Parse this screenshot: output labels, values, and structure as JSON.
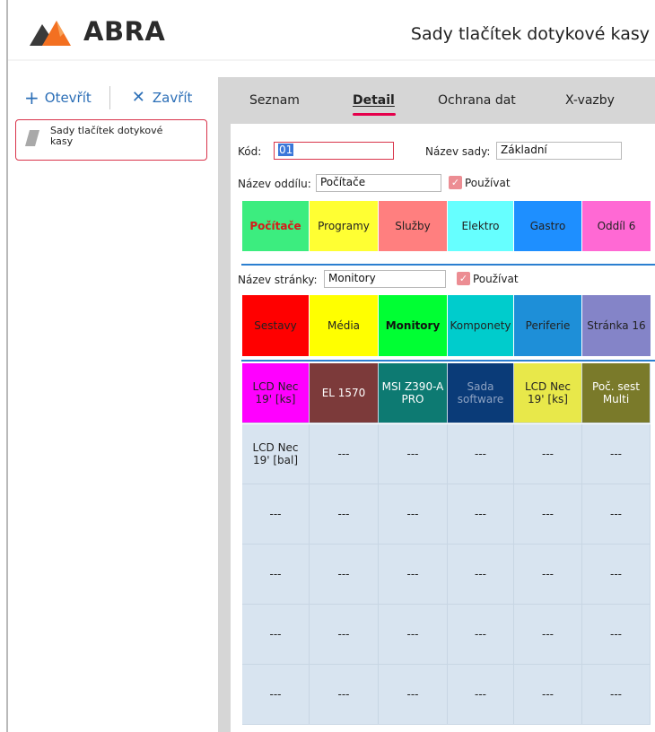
{
  "app": {
    "logo_text": "ABRA",
    "title": "Sady tlačítek dotykové kasy"
  },
  "toolbar": {
    "open_label": "Otevřít",
    "close_label": "Zavřít"
  },
  "sidebar": {
    "items": [
      {
        "label": "Sady tlačítek dotykové kasy",
        "active": true
      }
    ]
  },
  "tabs": [
    {
      "label": "Seznam",
      "active": false
    },
    {
      "label": "Detail",
      "active": true
    },
    {
      "label": "Ochrana dat",
      "active": false
    },
    {
      "label": "X-vazby",
      "active": false
    }
  ],
  "form": {
    "kod_label": "Kód:",
    "kod_value": "01",
    "nazev_sady_label": "Název sady:",
    "nazev_sady_value": "Základní",
    "nazev_oddilu_label": "Název oddílu:",
    "nazev_oddilu_value": "Počítače",
    "oddil_pouzivat_label": "Používat",
    "oddil_pouzivat_checked": true,
    "nazev_stranky_label": "Název stránky:",
    "nazev_stranky_value": "Monitory",
    "stranka_pouzivat_label": "Používat",
    "stranka_pouzivat_checked": true
  },
  "sections": [
    {
      "label": "Počítače",
      "bg": "#3ced7f",
      "color": "#d71a1a",
      "bold": true
    },
    {
      "label": "Programy",
      "bg": "#ffff33",
      "color": "#222222",
      "bold": false
    },
    {
      "label": "Služby",
      "bg": "#ff7f7f",
      "color": "#222222",
      "bold": false
    },
    {
      "label": "Elektro",
      "bg": "#66ffff",
      "color": "#222222",
      "bold": false
    },
    {
      "label": "Gastro",
      "bg": "#1e8fff",
      "color": "#222222",
      "bold": false
    },
    {
      "label": "Oddíl 6",
      "bg": "#ff69d4",
      "color": "#222222",
      "bold": false
    }
  ],
  "pages": [
    {
      "label": "Sestavy",
      "bg": "#ff0000",
      "color": "#222222",
      "bold": false
    },
    {
      "label": "Média",
      "bg": "#ffff00",
      "color": "#222222",
      "bold": false
    },
    {
      "label": "Monitory",
      "bg": "#00ff33",
      "color": "#111111",
      "bold": true
    },
    {
      "label": "Komponety",
      "bg": "#00cccc",
      "color": "#222222",
      "bold": false
    },
    {
      "label": "Periferie",
      "bg": "#1e8fd8",
      "color": "#222222",
      "bold": false
    },
    {
      "label": "Stránka 16",
      "bg": "#8484c8",
      "color": "#222222",
      "bold": false
    }
  ],
  "buttons": [
    [
      {
        "label": "LCD Nec 19' [ks]",
        "bg": "#ff00ff",
        "color": "#222222"
      },
      {
        "label": "EL 1570",
        "bg": "#7c3a3a",
        "color": "#ffffff"
      },
      {
        "label": "MSI Z390-A PRO",
        "bg": "#0d7a72",
        "color": "#ffffff"
      },
      {
        "label": "Sada software",
        "bg": "#0a3b78",
        "color": "#8da2c2"
      },
      {
        "label": "LCD Nec 19' [ks]",
        "bg": "#e8e84a",
        "color": "#222222"
      },
      {
        "label": "Poč. sest Multi",
        "bg": "#7a7a2a",
        "color": "#ffffff"
      }
    ],
    [
      {
        "label": "LCD Nec 19' [bal]",
        "bg": "#d8e4f0",
        "color": "#222222"
      },
      {
        "label": "---",
        "bg": "#d8e4f0",
        "color": "#222222"
      },
      {
        "label": "---",
        "bg": "#d8e4f0",
        "color": "#222222"
      },
      {
        "label": "---",
        "bg": "#d8e4f0",
        "color": "#222222"
      },
      {
        "label": "---",
        "bg": "#d8e4f0",
        "color": "#222222"
      },
      {
        "label": "---",
        "bg": "#d8e4f0",
        "color": "#222222"
      }
    ],
    [
      {
        "label": "---",
        "bg": "#d8e4f0",
        "color": "#222222"
      },
      {
        "label": "---",
        "bg": "#d8e4f0",
        "color": "#222222"
      },
      {
        "label": "---",
        "bg": "#d8e4f0",
        "color": "#222222"
      },
      {
        "label": "---",
        "bg": "#d8e4f0",
        "color": "#222222"
      },
      {
        "label": "---",
        "bg": "#d8e4f0",
        "color": "#222222"
      },
      {
        "label": "---",
        "bg": "#d8e4f0",
        "color": "#222222"
      }
    ],
    [
      {
        "label": "---",
        "bg": "#d8e4f0",
        "color": "#222222"
      },
      {
        "label": "---",
        "bg": "#d8e4f0",
        "color": "#222222"
      },
      {
        "label": "---",
        "bg": "#d8e4f0",
        "color": "#222222"
      },
      {
        "label": "---",
        "bg": "#d8e4f0",
        "color": "#222222"
      },
      {
        "label": "---",
        "bg": "#d8e4f0",
        "color": "#222222"
      },
      {
        "label": "---",
        "bg": "#d8e4f0",
        "color": "#222222"
      }
    ],
    [
      {
        "label": "---",
        "bg": "#d8e4f0",
        "color": "#222222"
      },
      {
        "label": "---",
        "bg": "#d8e4f0",
        "color": "#222222"
      },
      {
        "label": "---",
        "bg": "#d8e4f0",
        "color": "#222222"
      },
      {
        "label": "---",
        "bg": "#d8e4f0",
        "color": "#222222"
      },
      {
        "label": "---",
        "bg": "#d8e4f0",
        "color": "#222222"
      },
      {
        "label": "---",
        "bg": "#d8e4f0",
        "color": "#222222"
      }
    ],
    [
      {
        "label": "---",
        "bg": "#d8e4f0",
        "color": "#222222"
      },
      {
        "label": "---",
        "bg": "#d8e4f0",
        "color": "#222222"
      },
      {
        "label": "---",
        "bg": "#d8e4f0",
        "color": "#222222"
      },
      {
        "label": "---",
        "bg": "#d8e4f0",
        "color": "#222222"
      },
      {
        "label": "---",
        "bg": "#d8e4f0",
        "color": "#222222"
      },
      {
        "label": "---",
        "bg": "#d8e4f0",
        "color": "#222222"
      }
    ]
  ],
  "icons": {
    "logo": "abra-logo-icon",
    "open": "plus-icon",
    "close": "close-icon",
    "nav": "document-icon",
    "check": "checkmark-icon"
  }
}
